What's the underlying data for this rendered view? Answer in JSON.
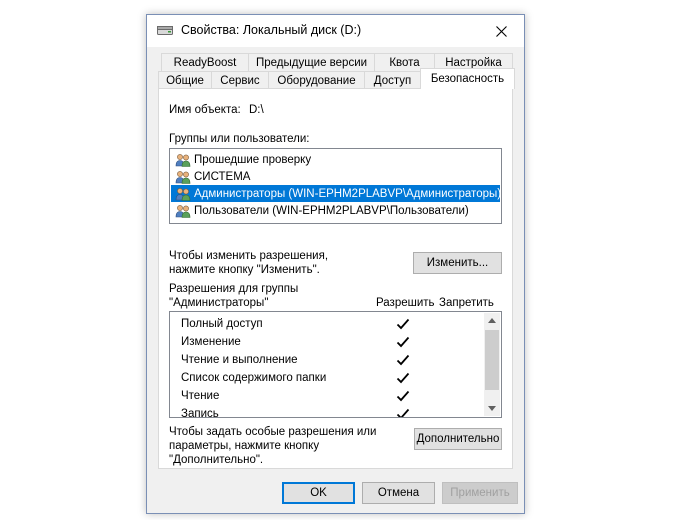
{
  "window": {
    "title": "Свойства: Локальный диск (D:)"
  },
  "tabs_row1": [
    {
      "label": "ReadyBoost"
    },
    {
      "label": "Предыдущие версии"
    },
    {
      "label": "Квота"
    },
    {
      "label": "Настройка"
    }
  ],
  "tabs_row2": [
    {
      "label": "Общие"
    },
    {
      "label": "Сервис"
    },
    {
      "label": "Оборудование"
    },
    {
      "label": "Доступ"
    },
    {
      "label": "Безопасность",
      "active": true
    }
  ],
  "object": {
    "label": "Имя объекта:",
    "value": "D:\\"
  },
  "groups": {
    "label": "Группы или пользователи:",
    "items": [
      {
        "label": "Прошедшие проверку",
        "selected": false
      },
      {
        "label": "СИСТЕМА",
        "selected": false
      },
      {
        "label": "Администраторы (WIN-EPHM2PLABVP\\Администраторы)",
        "selected": true
      },
      {
        "label": "Пользователи (WIN-EPHM2PLABVP\\Пользователи)",
        "selected": false
      }
    ]
  },
  "change": {
    "hint_line1": "Чтобы изменить разрешения,",
    "hint_line2": "нажмите кнопку \"Изменить\".",
    "button": "Изменить..."
  },
  "permissions": {
    "label_line1": "Разрешения для группы",
    "label_line2": "\"Администраторы\"",
    "allow_header": "Разрешить",
    "deny_header": "Запретить",
    "items": [
      {
        "label": "Полный доступ",
        "allow": true,
        "deny": false
      },
      {
        "label": "Изменение",
        "allow": true,
        "deny": false
      },
      {
        "label": "Чтение и выполнение",
        "allow": true,
        "deny": false
      },
      {
        "label": "Список содержимого папки",
        "allow": true,
        "deny": false
      },
      {
        "label": "Чтение",
        "allow": true,
        "deny": false
      },
      {
        "label": "Запись",
        "allow": true,
        "deny": false
      }
    ]
  },
  "advanced": {
    "hint_line1": "Чтобы задать особые разрешения или",
    "hint_line2": "параметры, нажмите кнопку",
    "hint_line3": "\"Дополнительно\".",
    "button": "Дополнительно"
  },
  "footer": {
    "ok": "OK",
    "cancel": "Отмена",
    "apply": "Применить"
  },
  "colors": {
    "selection": "#0078d7",
    "window_bg": "#f0f0f0"
  }
}
